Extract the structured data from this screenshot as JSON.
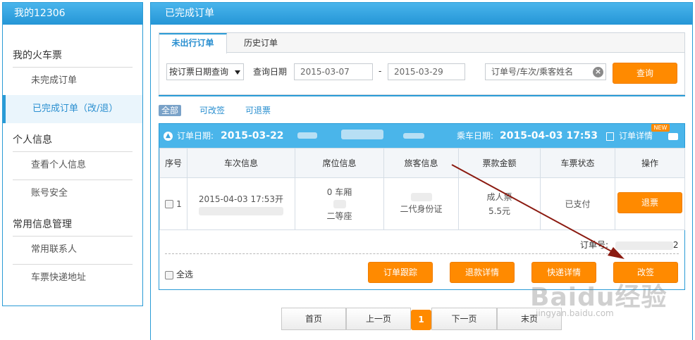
{
  "sidebar": {
    "title": "我的12306",
    "sections": [
      {
        "label": "我的火车票",
        "items": [
          "未完成订单",
          "已完成订单（改/退）"
        ]
      },
      {
        "label": "个人信息",
        "items": [
          "查看个人信息",
          "账号安全"
        ]
      },
      {
        "label": "常用信息管理",
        "items": [
          "常用联系人",
          "车票快递地址"
        ]
      }
    ]
  },
  "main": {
    "title": "已完成订单",
    "tabs": [
      "未出行订单",
      "历史订单"
    ],
    "query_type": "按订票日期查询",
    "date_label": "查询日期",
    "date_from": "2015-03-07",
    "date_sep": "-",
    "date_to": "2015-03-29",
    "keyword_placeholder": "订单号/车次/乘客姓名",
    "query_button": "查询",
    "filters": [
      "全部",
      "可改签",
      "可退票"
    ]
  },
  "order": {
    "order_date_label": "订单日期:",
    "order_date": "2015-03-22",
    "travel_date_label": "乘车日期:",
    "travel_datetime": "2015-04-03 17:53",
    "detail_link": "订单详情",
    "new_badge": "NEW",
    "columns": [
      "序号",
      "车次信息",
      "席位信息",
      "旅客信息",
      "票款金额",
      "车票状态",
      "操作"
    ],
    "row": {
      "index": "1",
      "train_time": "2015-04-03 17:53开",
      "seat_carriage": "0 车厢",
      "seat_class": "二等座",
      "passenger_id_type": "二代身份证",
      "ticket_type": "成人票",
      "price": "5.5元",
      "status": "已支付",
      "action": "退票"
    },
    "order_no_label": "订单号:",
    "order_no_tail": "2",
    "select_all": "全选",
    "buttons": [
      "订单跟踪",
      "退款详情",
      "快递详情",
      "改签"
    ]
  },
  "pager": {
    "first": "首页",
    "prev": "上一页",
    "current": "1",
    "next": "下一页",
    "last": "末页"
  },
  "watermark": {
    "brand": "Baidu经验",
    "url": "jingyan.baidu.com"
  },
  "colors": {
    "accent_blue": "#2a9bd6",
    "bar_blue": "#4ab5ea",
    "orange": "#ff8a00",
    "arrow_red": "#8b1a10"
  }
}
